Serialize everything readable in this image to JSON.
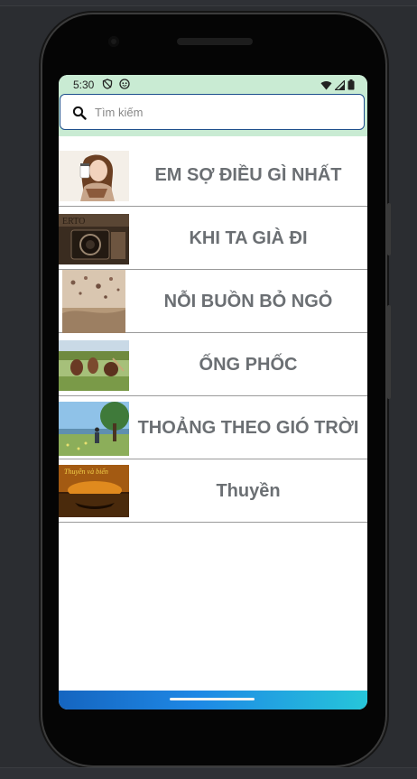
{
  "status_bar": {
    "time": "5:30",
    "icons": [
      "vpn-icon",
      "assistant-icon",
      "wifi-icon",
      "signal-icon",
      "battery-icon"
    ]
  },
  "search": {
    "placeholder": "Tìm kiếm",
    "value": ""
  },
  "songs": [
    {
      "title": "EM SỢ ĐIỀU GÌ NHẤT",
      "thumbnail": "girl-with-cup-image"
    },
    {
      "title": "KHI TA GIÀ ĐI",
      "thumbnail": "vintage-camera-image"
    },
    {
      "title": "NỖI BUỒN BỎ NGỎ",
      "thumbnail": "hot-air-balloons-image"
    },
    {
      "title": "ỐNG PHỐC",
      "thumbnail": "children-in-field-image"
    },
    {
      "title": "THOẢNG THEO GIÓ TRỜI",
      "thumbnail": "person-under-tree-image"
    },
    {
      "title": "Thuyền",
      "thumbnail": "boat-sunset-image"
    }
  ],
  "colors": {
    "status_bar_bg": "#c9ebd3",
    "search_border": "#1e4f8c",
    "title_text": "#6b6f73",
    "nav_gradient_start": "#1565c0",
    "nav_gradient_end": "#26c6da"
  }
}
